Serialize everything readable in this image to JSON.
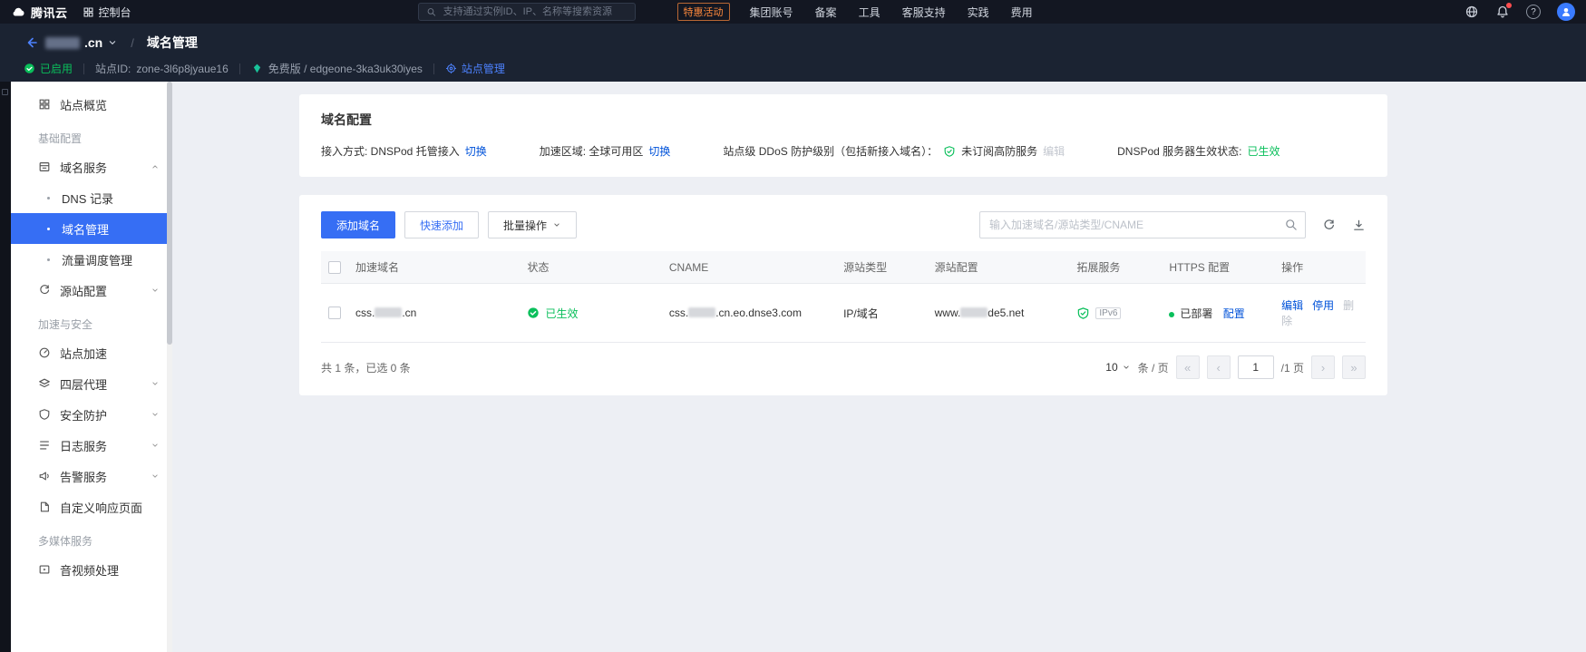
{
  "colors": {
    "accent_blue": "#366ef4",
    "link_blue": "#0052d9",
    "success_green": "#0abf5b",
    "promo_orange": "#ff8a3c"
  },
  "topbar": {
    "brand": "腾讯云",
    "console_label": "控制台",
    "search_placeholder": "支持通过实例ID、IP、名称等搜索资源",
    "promo": "特惠活动",
    "links": [
      "集团账号",
      "备案",
      "工具",
      "客服支持",
      "实践",
      "费用"
    ],
    "help_glyph": "?"
  },
  "site_header": {
    "site_suffix": ".cn",
    "divider": "/",
    "breadcrumb_current": "域名管理",
    "status_badge": "已启用",
    "site_id_label": "站点ID:",
    "site_id": "zone-3l6p8jyaue16",
    "plan": "免费版 / edgeone-3ka3uk30iyes",
    "site_manage": "站点管理"
  },
  "sidebar": {
    "items": [
      "站点概览",
      "基础配置",
      "域名服务",
      "DNS 记录",
      "域名管理",
      "流量调度管理",
      "源站配置",
      "加速与安全",
      "站点加速",
      "四层代理",
      "安全防护",
      "日志服务",
      "告警服务",
      "自定义响应页面",
      "多媒体服务",
      "音视频处理"
    ]
  },
  "config_card": {
    "title": "域名配置",
    "access_label": "接入方式: DNSPod 托管接入",
    "access_action": "切换",
    "region_label": "加速区域: 全球可用区",
    "region_action": "切换",
    "ddos_label": "站点级 DDoS 防护级别（包括新接入域名）：",
    "ddos_value": "未订阅高防服务",
    "ddos_action": "编辑",
    "dns_label": "DNSPod 服务器生效状态:",
    "dns_value": "已生效"
  },
  "domain_table": {
    "add_button": "添加域名",
    "quick_add_button": "快速添加",
    "batch_button": "批量操作",
    "search_placeholder": "输入加速域名/源站类型/CNAME",
    "columns": [
      "加速域名",
      "状态",
      "CNAME",
      "源站类型",
      "源站配置",
      "拓展服务",
      "HTTPS 配置",
      "操作"
    ],
    "row": {
      "domain_prefix": "css.",
      "domain_suffix": ".cn",
      "status": "已生效",
      "cname_prefix": "css.",
      "cname_suffix": ".cn.eo.dnse3.com",
      "origin_type": "IP/域名",
      "origin_prefix": "www.",
      "origin_suffix": "de5.net",
      "ipv6_badge": "IPv6",
      "https_status": "已部署",
      "https_action": "配置",
      "action_edit": "编辑",
      "action_disable": "停用",
      "action_delete": "删除"
    },
    "footer": {
      "summary": "共 1 条，已选 0 条",
      "page_size": "10",
      "page_size_unit": "条 / 页",
      "current_page": "1",
      "total_pages": "/1 页",
      "pager_first": "«",
      "pager_prev": "‹",
      "pager_next": "›",
      "pager_last": "»"
    }
  }
}
